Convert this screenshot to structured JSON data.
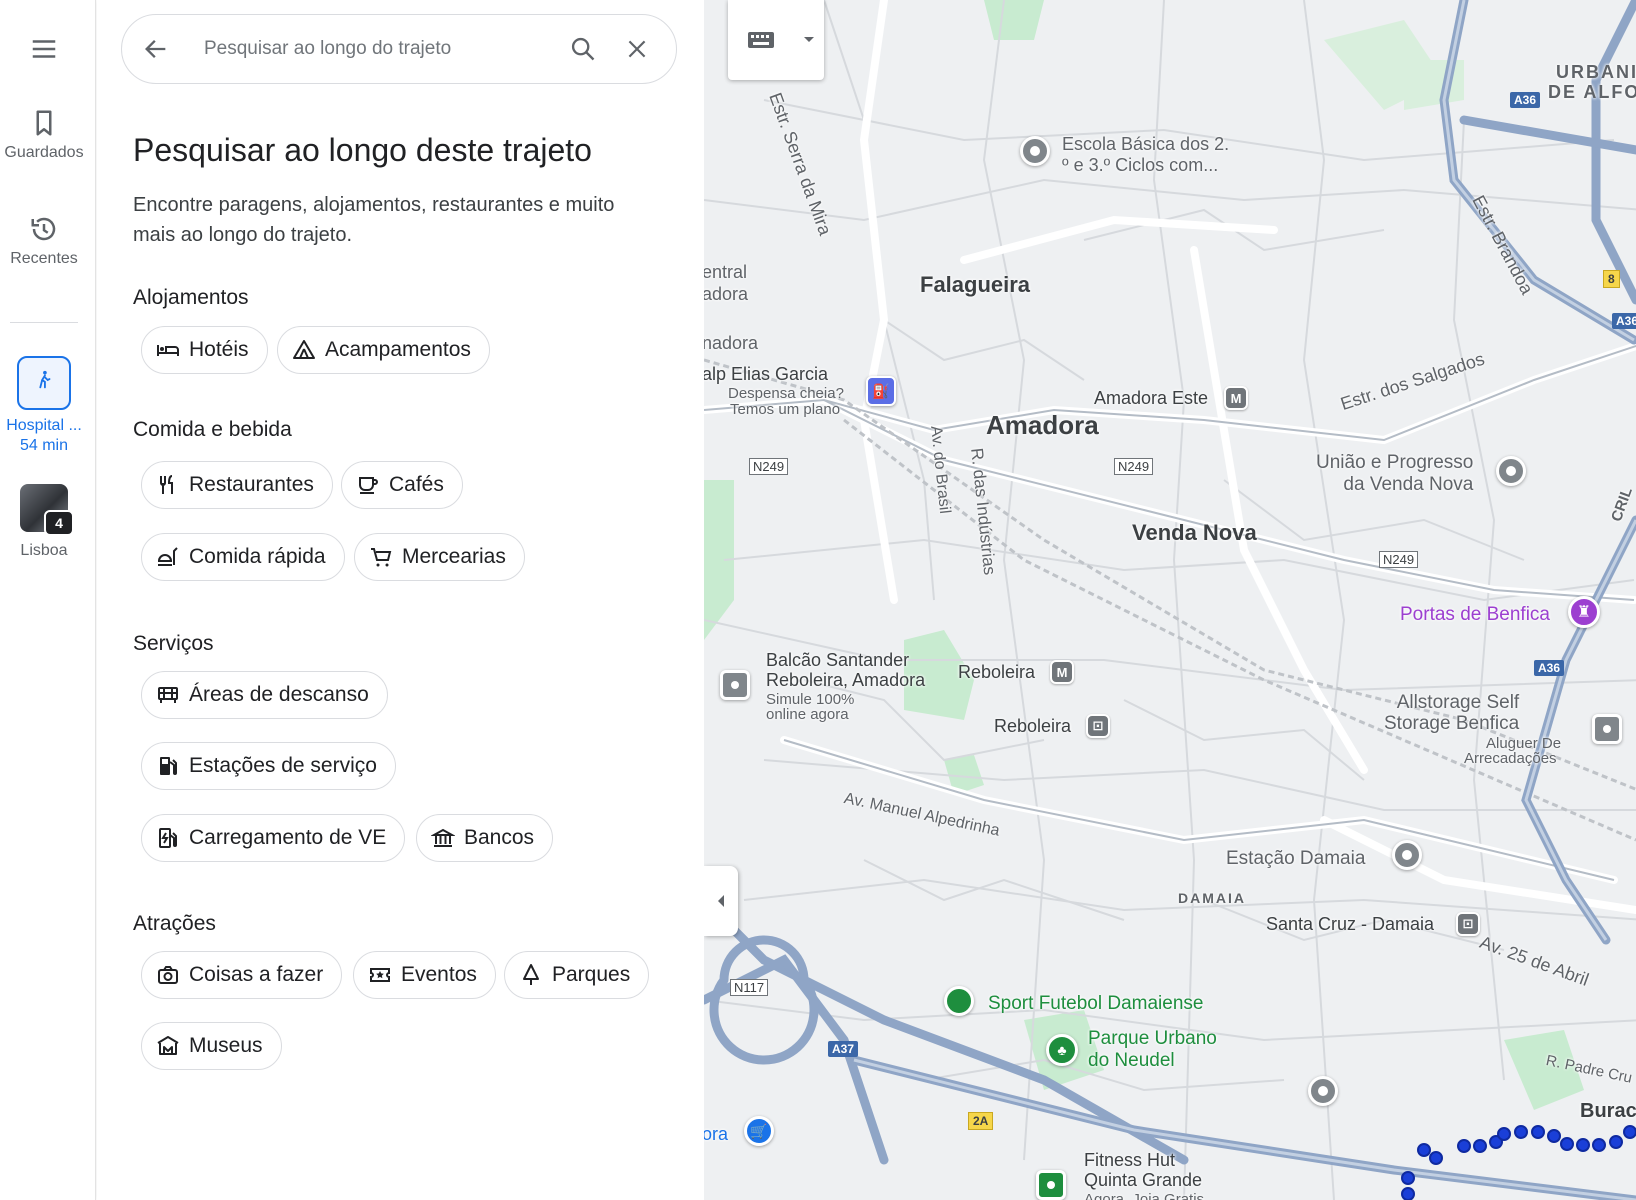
{
  "rail": {
    "saved_label": "Guardados",
    "recent_label": "Recentes",
    "trip_label_1": "Hospital ...",
    "trip_label_2": "54 min",
    "recent_place": "Lisboa",
    "recent_count": "4"
  },
  "search": {
    "placeholder": "Pesquisar ao longo do trajeto"
  },
  "panel": {
    "title": "Pesquisar ao longo deste trajeto",
    "description": "Encontre paragens, alojamentos, restaurantes e muito mais ao longo do trajeto."
  },
  "sections": {
    "lodging": {
      "title": "Alojamentos",
      "hotels": "Hotéis",
      "camping": "Acampamentos"
    },
    "food": {
      "title": "Comida e bebida",
      "restaurants": "Restaurantes",
      "cafes": "Cafés",
      "fastfood": "Comida rápida",
      "groceries": "Mercearias"
    },
    "services": {
      "title": "Serviços",
      "rest_areas": "Áreas de descanso",
      "gas": "Estações de serviço",
      "ev": "Carregamento de VE",
      "banks": "Bancos"
    },
    "attractions": {
      "title": "Atrações",
      "things": "Coisas a fazer",
      "events": "Eventos",
      "parks": "Parques",
      "museums": "Museus"
    }
  },
  "map": {
    "labels": {
      "serra_mira": "Estr. Serra da Mira",
      "escola": "Escola Básica dos 2.",
      "escola2": "º e 3.º Ciclos com...",
      "urbani": "URBANI",
      "dealfo": "DE ALFO",
      "brandoa": "Estr. Brandoa",
      "central": "entral",
      "adora1": "adora",
      "falagueira": "Falagueira",
      "nadora": "nadora",
      "galp": "alp Elias Garcia",
      "galp_sub1": "Despensa cheia?",
      "galp_sub2": "Temos um plano",
      "amadora_este": "Amadora Este",
      "salgados": "Estr. dos Salgados",
      "amadora": "Amadora",
      "av_brasil": "Av. do Brasil",
      "r_industrias": "R. das Indústrias",
      "uniao1": "União e Progresso",
      "uniao2": "da Venda Nova",
      "venda_nova": "Venda Nova",
      "portas": "Portas de Benfica",
      "santander1": "Balcão Santander",
      "santander2": "Reboleira, Amadora",
      "santander3": "Simule 100%",
      "santander4": "online agora",
      "reboleira_m": "Reboleira",
      "reboleira_t": "Reboleira",
      "allstorage1": "Allstorage Self",
      "allstorage2": "Storage Benfica",
      "allstorage3": "Aluguer De",
      "allstorage4": "Arrecadações",
      "alpedrinha": "Av. Manuel Alpedrinha",
      "estacao_damaia": "Estação Damaia",
      "damaia": "DAMAIA",
      "santa_cruz": "Santa Cruz - Damaia",
      "av_25_abril": "Av. 25 de Abril",
      "sport": "Sport Futebol Damaiense",
      "parque1": "Parque Urbano",
      "parque2": "do Neudel",
      "padre": "R. Padre Cru",
      "burac": "Burac",
      "ora": "ora",
      "fitness1": "Fitness Hut",
      "fitness2": "Quinta Grande",
      "fitness3": "Agora, Joia Gratis",
      "cril": "CRIL"
    },
    "shields": {
      "n249a": "N249",
      "n249b": "N249",
      "n249c": "N249",
      "n117": "N117",
      "a36a": "A36",
      "a36b": "A36",
      "a36c": "A36",
      "a37": "A37",
      "a2a": "2A",
      "e8": "8"
    },
    "metro": "M",
    "colors": {
      "route": "#1a3fd8",
      "highway": "#8fa5c6",
      "park": "#c8ebd0",
      "poi_purple": "#9c3fd0",
      "poi_green": "#1e8e3e"
    }
  }
}
